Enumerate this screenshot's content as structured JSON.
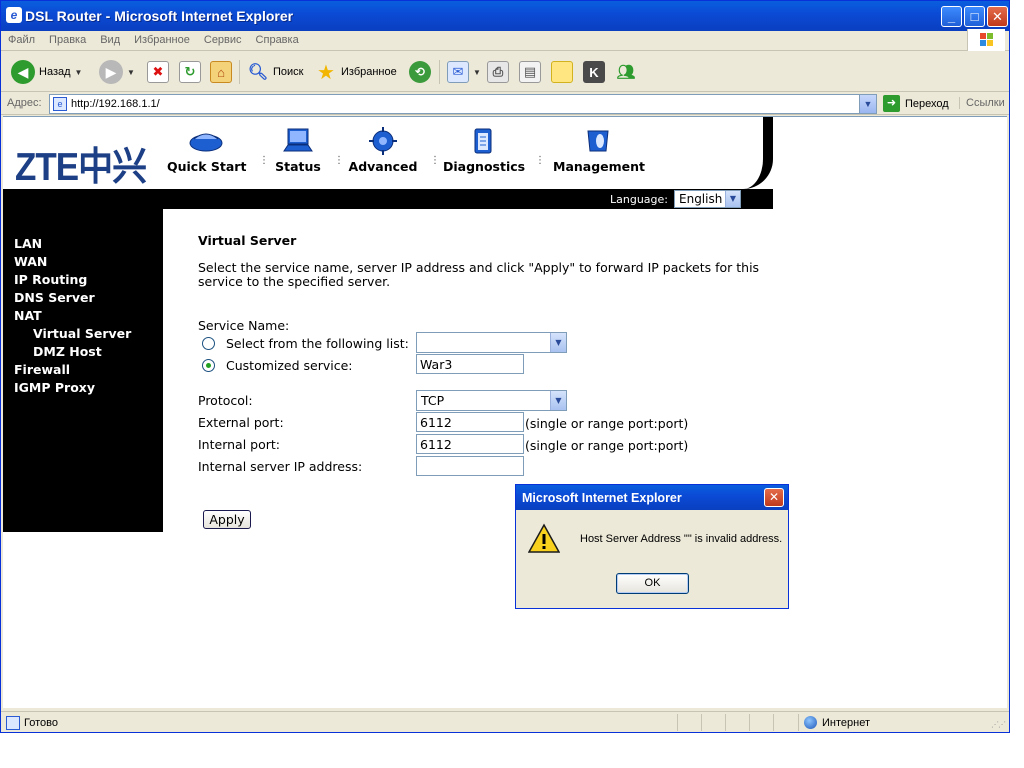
{
  "window": {
    "title": "DSL Router - Microsoft Internet Explorer",
    "controls": {
      "minimize": "_",
      "maximize": "□",
      "close": "✕"
    }
  },
  "menu": [
    "Файл",
    "Правка",
    "Вид",
    "Избранное",
    "Сервис",
    "Справка"
  ],
  "toolbar": {
    "back_label": "Назад",
    "search_label": "Поиск",
    "favorites_label": "Избранное"
  },
  "address": {
    "label": "Адрес:",
    "url": "http://192.168.1.1/",
    "go_label": "Переход",
    "links_label": "Ссылки"
  },
  "router": {
    "logo": "ZTE中兴",
    "nav": [
      "Quick Start",
      "Status",
      "Advanced",
      "Diagnostics",
      "Management"
    ],
    "language_label": "Language:",
    "language_value": "English",
    "sidebar": [
      "LAN",
      "WAN",
      "IP Routing",
      "DNS Server",
      "NAT",
      "Virtual Server",
      "DMZ Host",
      "Firewall",
      "IGMP Proxy"
    ]
  },
  "form": {
    "title": "Virtual Server",
    "description": "Select the service name, server IP address and click \"Apply\" to forward IP packets for this service to the specified server.",
    "service_name_label": "Service Name:",
    "select_list_label": "Select from the following list:",
    "select_list_value": "",
    "customized_label": "Customized service:",
    "customized_value": "War3",
    "protocol_label": "Protocol:",
    "protocol_value": "TCP",
    "external_port_label": "External port:",
    "external_port_value": "6112",
    "internal_port_label": "Internal port:",
    "internal_port_value": "6112",
    "port_hint": "(single or range port:port)",
    "server_ip_label": "Internal server IP address:",
    "server_ip_value": "",
    "apply_label": "Apply"
  },
  "dialog": {
    "title": "Microsoft Internet Explorer",
    "message": "Host Server Address \"\" is invalid address.",
    "ok_label": "OK"
  },
  "status": {
    "text": "Готово",
    "zone": "Интернет"
  },
  "colors": {
    "titlebar": "#0b4bd6",
    "logo": "#1d3f86",
    "sidebar": "#000000",
    "chrome": "#ece9d8"
  }
}
